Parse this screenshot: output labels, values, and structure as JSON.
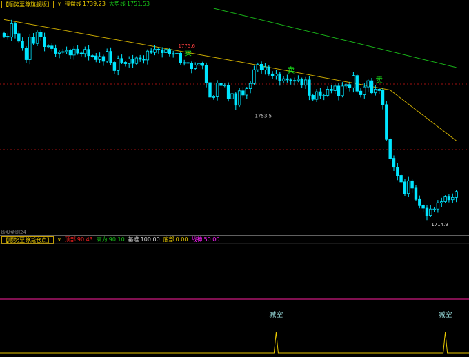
{
  "top_panel": {
    "indicator_name": "【顺势至尊旗舰版】",
    "dropdown_mark": "∨",
    "ma_items": [
      {
        "label": "操盘线",
        "value": "1739.23",
        "color": "#e8c800"
      },
      {
        "label": "大势线",
        "value": "1751.53",
        "color": "#18c418"
      }
    ],
    "high_label": "1775.6",
    "low_labels": [
      "1753.5",
      "1714.9"
    ],
    "sell_signal": "卖",
    "watermark": "炒股金刚24"
  },
  "bottom_panel": {
    "indicator_name": "【顺势至尊减仓点】",
    "dropdown_mark": "∨",
    "items": [
      {
        "label": "顶部",
        "value": "90.43",
        "color": "#ff2020"
      },
      {
        "label": "高为",
        "value": "90.10",
        "color": "#18c418"
      },
      {
        "label": "基准",
        "value": "100.00",
        "color": "#d8d8d8"
      },
      {
        "label": "底部",
        "value": "0.00",
        "color": "#e8c800"
      },
      {
        "label": "战神",
        "value": "50.00",
        "color": "#ff20ff"
      }
    ],
    "signal_label": "减空"
  },
  "colors": {
    "candle": "#00e5ff",
    "operating_line": "#c8a800",
    "trend_line": "#18b418",
    "grid": "#a01010",
    "sell": "#18e018",
    "peak": "#ff4040",
    "low_label": "#d8d8d8",
    "bottom_magenta": "#ff20a0",
    "spike": "#e8c800"
  },
  "chart_data": {
    "type": "candlestick",
    "y_range": [
      1712,
      1790
    ],
    "closes": [
      1780.1,
      1779.8,
      1784.5,
      1781.0,
      1778.3,
      1775.9,
      1771.8,
      1779.8,
      1777.5,
      1781.5,
      1779.9,
      1776.4,
      1776.6,
      1775.7,
      1774.0,
      1774.4,
      1774.6,
      1775.0,
      1773.4,
      1775.5,
      1774.1,
      1773.9,
      1775.4,
      1773.2,
      1773.1,
      1771.8,
      1772.9,
      1771.2,
      1774.7,
      1770.8,
      1767.9,
      1772.2,
      1770.8,
      1770.3,
      1772.0,
      1770.4,
      1772.4,
      1771.9,
      1771.7,
      1774.8,
      1774.3,
      1775.5,
      1775.2,
      1774.2,
      1775.4,
      1773.9,
      1773.8,
      1774.0,
      1770.6,
      1770.7,
      1770.5,
      1768.6,
      1769.8,
      1770.4,
      1769.7,
      1763.6,
      1758.5,
      1758.6,
      1763.5,
      1762.6,
      1762.7,
      1757.9,
      1759.7,
      1755.6,
      1760.7,
      1759.2,
      1761.5,
      1763.3,
      1768.2,
      1770.1,
      1768.1,
      1769.2,
      1766.7,
      1766.0,
      1766.7,
      1764.2,
      1765.0,
      1764.6,
      1764.2,
      1764.4,
      1764.8,
      1762.7,
      1764.6,
      1759.1,
      1757.7,
      1760.4,
      1759.1,
      1759.1,
      1761.3,
      1760.8,
      1762.4,
      1759.0,
      1762.4,
      1762.9,
      1761.8,
      1766.1,
      1760.6,
      1759.3,
      1762.1,
      1764.3,
      1760.0,
      1761.3,
      1760.8,
      1755.8,
      1743.5,
      1736.8,
      1733.6,
      1730.7,
      1728.4,
      1724.3,
      1728.8,
      1726.2,
      1722.2,
      1720.0,
      1719.1,
      1716.5,
      1718.8,
      1718.8,
      1721.0,
      1721.4,
      1723.1,
      1722.1,
      1722.9,
      1725.0
    ],
    "operating_line": {
      "x_index": [
        0,
        64,
        105,
        123
      ],
      "y": [
        1786,
        1771,
        1761,
        1743
      ]
    },
    "trend_line": {
      "x_index": [
        57,
        123
      ],
      "y": [
        1790,
        1769
      ]
    },
    "high_marker": {
      "value": 1775.6,
      "index": 50
    },
    "low_markers": [
      {
        "value": 1753.5,
        "index": 69
      },
      {
        "value": 1714.9,
        "index": 117
      }
    ],
    "sell_signal_indices": [
      50,
      78,
      102
    ],
    "bottom_levels": {
      "magenta": 50.0
    },
    "bottom_spikes": [
      {
        "index": 74,
        "value": 100
      },
      {
        "index": 120,
        "value": 100
      }
    ]
  }
}
